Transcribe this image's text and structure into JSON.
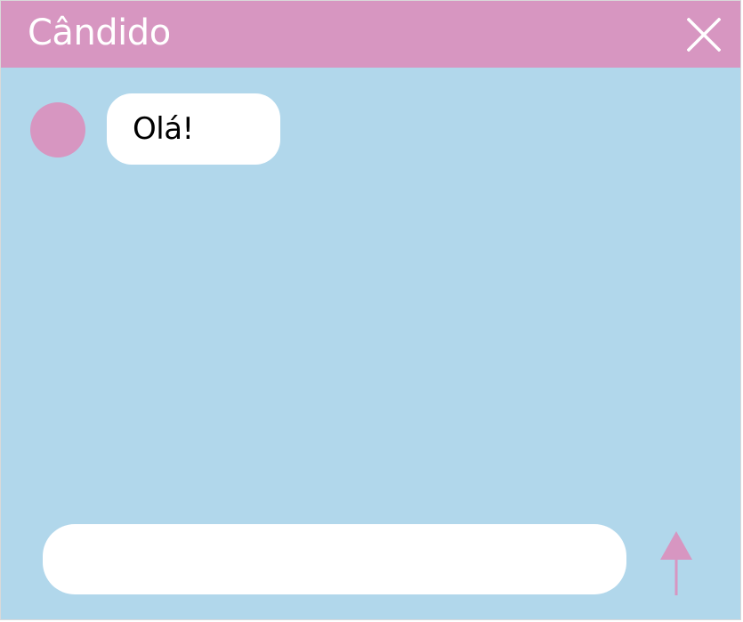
{
  "window": {
    "title": "Cândido",
    "close_icon": "close-icon"
  },
  "colors": {
    "header": "#d796c1",
    "background": "#b1d7eb",
    "bubble": "#ffffff",
    "accent": "#d796c1"
  },
  "messages": [
    {
      "sender_avatar": "avatar-circle",
      "text": "Olá!"
    }
  ],
  "composer": {
    "value": "",
    "placeholder": "",
    "send_icon": "arrow-up-icon"
  }
}
